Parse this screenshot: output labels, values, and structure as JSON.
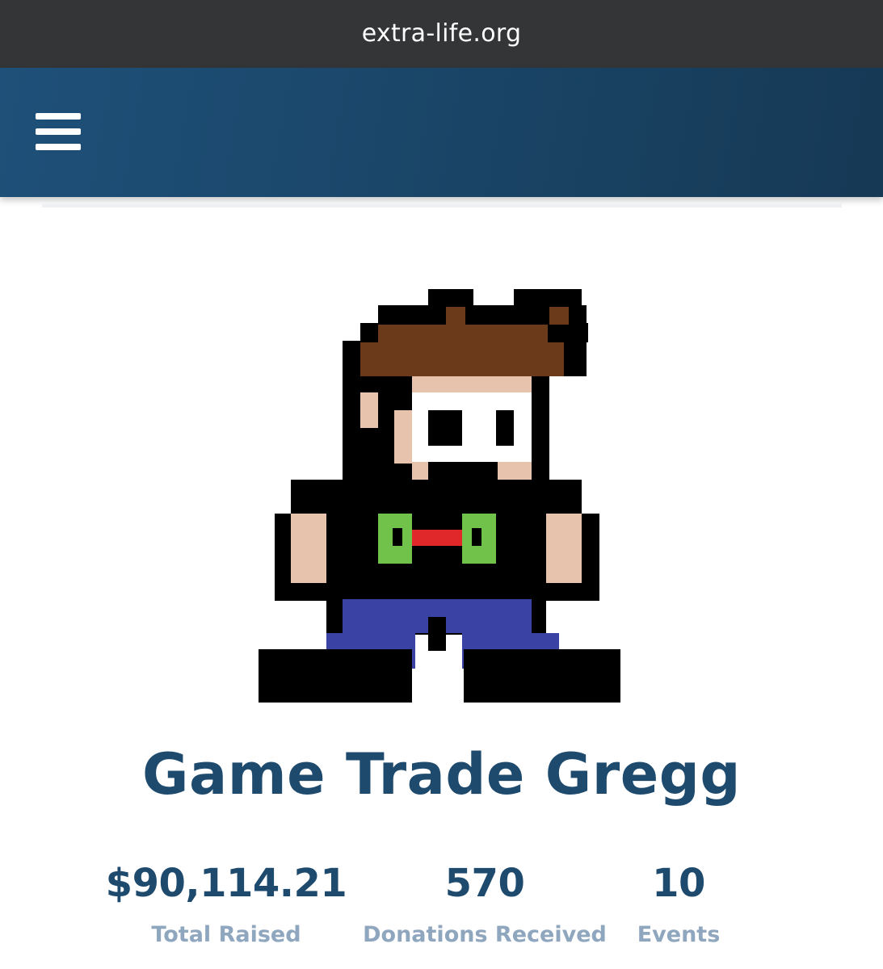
{
  "browser": {
    "url": "extra-life.org"
  },
  "header": {
    "menu_icon": "hamburger-menu-icon",
    "brand_color": "#1b4a6f"
  },
  "profile": {
    "avatar_icon": "pixel-art-avatar",
    "name": "Game Trade Gregg"
  },
  "stats": [
    {
      "value": "$90,114.21",
      "label": "Total Raised"
    },
    {
      "value": "570",
      "label": "Donations Received"
    },
    {
      "value": "10",
      "label": "Events"
    }
  ],
  "colors": {
    "name_text": "#1e4a6e",
    "stat_label": "#8fa6bf",
    "url_bar": "#333537"
  }
}
